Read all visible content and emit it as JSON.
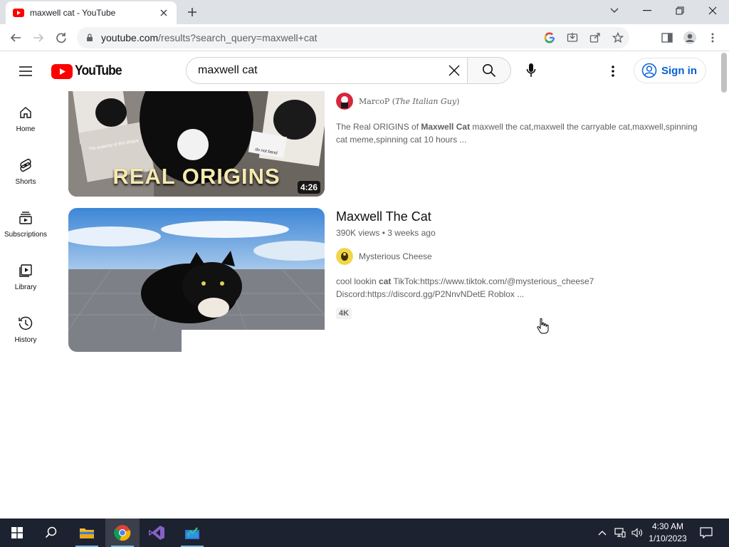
{
  "browser": {
    "tab": {
      "title": "maxwell cat - YouTube"
    },
    "address": {
      "host": "youtube.com",
      "path": "/results?search_query=maxwell+cat"
    }
  },
  "youtube": {
    "logo_text": "YouTube",
    "search": {
      "query": "maxwell cat",
      "placeholder": "Search"
    },
    "signin_label": "Sign in"
  },
  "guide": {
    "items": [
      {
        "label": "Home",
        "icon": "home-icon"
      },
      {
        "label": "Shorts",
        "icon": "shorts-icon"
      },
      {
        "label": "Subscriptions",
        "icon": "subscriptions-icon"
      },
      {
        "label": "Library",
        "icon": "library-icon"
      },
      {
        "label": "History",
        "icon": "history-icon"
      }
    ]
  },
  "results": [
    {
      "thumbnail_text": "REAL ORIGINS",
      "thumbnail_captions": [
        "The audacity of this dingus",
        "do not bend"
      ],
      "duration": "4:26",
      "channel": "MarcoP",
      "channel_suffix": "The Italian Guy",
      "description": {
        "pre": "The Real ORIGINS of ",
        "bold": "Maxwell Cat",
        "post": " maxwell the cat,maxwell the carryable cat,maxwell,spinning cat meme,spinning cat 10 hours ..."
      }
    },
    {
      "title": "Maxwell The Cat",
      "views": "390K views",
      "age": "3 weeks ago",
      "channel": "Mysterious Cheese",
      "description": {
        "pre": "cool lookin ",
        "bold": "cat",
        "post": " TikTok:https://www.tiktok.com/@mysterious_cheese7 Discord:https://discord.gg/P2NnvNDetE Roblox ..."
      },
      "badge": "4K"
    }
  ],
  "taskbar": {
    "apps": [
      "start",
      "search",
      "file-explorer",
      "chrome",
      "visual-studio",
      "app"
    ],
    "time": "4:30 AM",
    "date": "1/10/2023"
  },
  "colors": {
    "youtube_red": "#ff0000",
    "link_blue": "#065fd4",
    "taskbar": "#1c2230",
    "tabstrip": "#dee1e6"
  }
}
